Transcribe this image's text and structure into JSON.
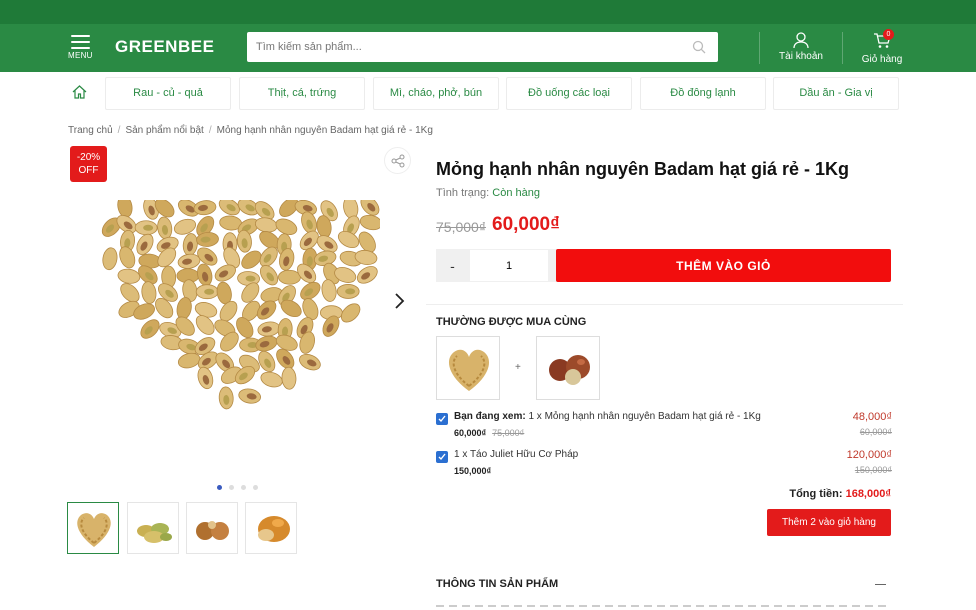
{
  "header": {
    "menu_label": "MENU",
    "logo": "GREENBEE",
    "search_placeholder": "Tìm kiếm sản phẩm...",
    "account_label": "Tài khoản",
    "cart_label": "Giỏ hàng",
    "cart_count": "0"
  },
  "categories": [
    "Rau - củ - quả",
    "Thịt, cá, trứng",
    "Mì, cháo, phở, bún",
    "Đồ uống các loại",
    "Đồ đông lạnh",
    "Dầu ăn - Gia vị"
  ],
  "breadcrumb": [
    "Trang chủ",
    "Sản phẩm nổi bật",
    "Mỏng hạnh nhân nguyên Badam hạt giá rẻ - 1Kg"
  ],
  "product": {
    "badge_line1": "-20%",
    "badge_line2": "OFF",
    "title": "Mỏng hạnh nhân nguyên Badam hạt giá rẻ - 1Kg",
    "status_label": "Tình trạng:",
    "status_value": "Còn hàng",
    "old_price": "75,000₫",
    "price": "60,000₫",
    "qty_minus": "-",
    "qty_value": "1",
    "qty_plus": "+",
    "add_to_cart": "THÊM VÀO GIỎ"
  },
  "bought_together": {
    "title": "THƯỜNG ĐƯỢC MUA CÙNG",
    "plus": "+",
    "items": [
      {
        "prefix": "Bạn đang xem:",
        "name": "1 x Mỏng hạnh nhân nguyên Badam hạt giá rẻ - 1Kg",
        "unit_price": "60,000₫",
        "unit_old": "75,000₫",
        "line_price": "48,000₫",
        "line_old": "60,000₫",
        "checked": true
      },
      {
        "prefix": "",
        "name": "1 x Táo Juliet Hữu Cơ Pháp",
        "unit_price": "150,000₫",
        "unit_old": "",
        "line_price": "120,000₫",
        "line_old": "150,000₫",
        "checked": true
      }
    ],
    "total_label": "Tổng tiền:",
    "total_value": "168,000₫",
    "add_button": "Thêm 2 vào giỏ hàng"
  },
  "info": {
    "title": "THÔNG TIN SẢN PHẨM"
  },
  "gallery": {
    "slides": 4,
    "active_slide": 1
  },
  "colors": {
    "brand_green": "#2a8a44",
    "sale_red": "#e31b1b",
    "checkbox_blue": "#2b6fd1"
  },
  "icons": [
    "menu-icon",
    "search-icon",
    "user-icon",
    "cart-icon",
    "home-icon",
    "share-icon",
    "chevron-right-icon",
    "checkmark-icon",
    "minus-icon"
  ]
}
